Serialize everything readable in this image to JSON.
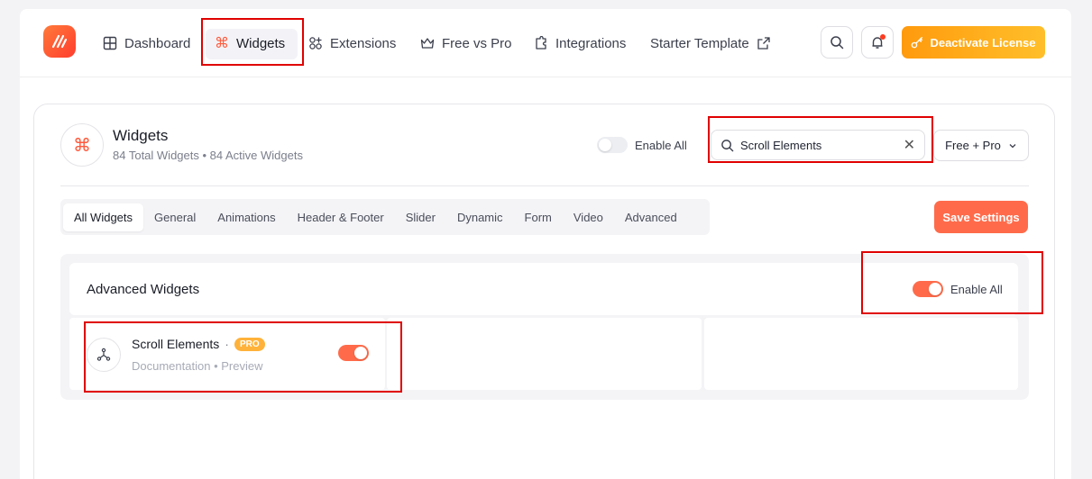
{
  "nav": {
    "items": [
      {
        "label": "Dashboard",
        "icon": "grid-icon"
      },
      {
        "label": "Widgets",
        "icon": "command-icon",
        "active": true
      },
      {
        "label": "Extensions",
        "icon": "extensions-icon"
      },
      {
        "label": "Free vs Pro",
        "icon": "crown-icon"
      },
      {
        "label": "Integrations",
        "icon": "puzzle-icon"
      },
      {
        "label": "Starter Template",
        "icon": "external-link-icon"
      }
    ],
    "deactivate_label": "Deactivate License"
  },
  "card": {
    "title": "Widgets",
    "subtitle": "84 Total Widgets • 84 Active Widgets",
    "enable_all_label": "Enable All",
    "search_value": "Scroll Elements",
    "filter_label": "Free + Pro",
    "save_label": "Save Settings",
    "tabs": [
      "All Widgets",
      "General",
      "Animations",
      "Header & Footer",
      "Slider",
      "Dynamic",
      "Form",
      "Video",
      "Advanced"
    ]
  },
  "advanced": {
    "title": "Advanced Widgets",
    "enable_all_label": "Enable All",
    "widget": {
      "name": "Scroll Elements",
      "separator": "·",
      "badge": "PRO",
      "doc_label": "Documentation",
      "link_sep": "•",
      "preview_label": "Preview"
    }
  },
  "colors": {
    "accent": "#ff6b4a",
    "license_gradient_start": "#ff9a0d",
    "license_gradient_end": "#ffbf2a",
    "highlight": "#e00000"
  }
}
